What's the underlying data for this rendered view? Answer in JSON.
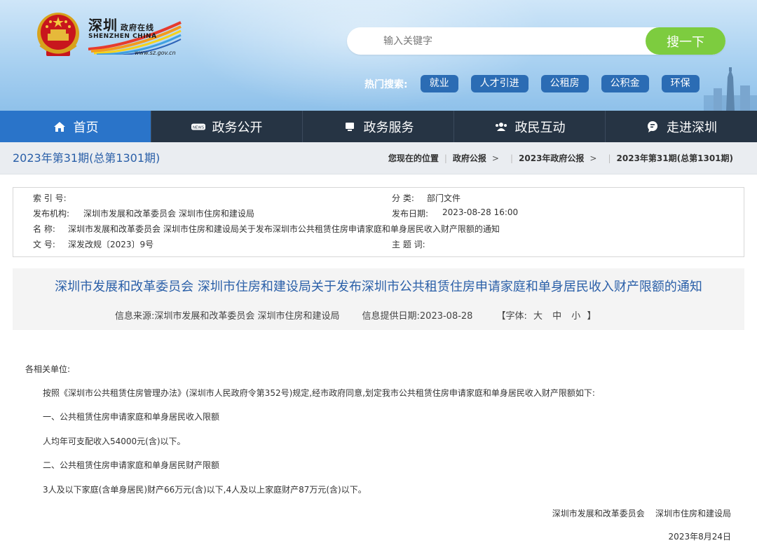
{
  "header": {
    "logo": {
      "cn": "深圳",
      "cn_small": "政府在线",
      "en": "SHENZHEN CHINA",
      "url": "www.sz.gov.cn"
    },
    "search": {
      "placeholder": "输入关键字",
      "button": "搜一下"
    },
    "hot": {
      "label": "热门搜索:",
      "tags": [
        "就业",
        "人才引进",
        "公租房",
        "公积金",
        "环保"
      ]
    }
  },
  "nav": {
    "items": [
      {
        "label": "首页",
        "icon": "home-icon"
      },
      {
        "label": "政务公开",
        "icon": "news-icon"
      },
      {
        "label": "政务服务",
        "icon": "monitor-icon"
      },
      {
        "label": "政民互动",
        "icon": "people-icon"
      },
      {
        "label": "走进深圳",
        "icon": "chat-icon"
      }
    ]
  },
  "breadcrumb": {
    "issue": "2023年第31期(总第1301期)",
    "location_label": "您现在的位置",
    "items": [
      "政府公报",
      "2023年政府公报",
      "2023年第31期(总第1301期)"
    ]
  },
  "meta": {
    "index_label": "索 引 号:",
    "index_value": "",
    "category_label": "分 类:",
    "category_value": "部门文件",
    "publisher_label": "发布机构:",
    "publisher_value": "深圳市发展和改革委员会 深圳市住房和建设局",
    "date_label": "发布日期:",
    "date_value": "2023-08-28 16:00",
    "name_label": "名 称:",
    "name_value": "深圳市发展和改革委员会 深圳市住房和建设局关于发布深圳市公共租赁住房申请家庭和单身居民收入财产限额的通知",
    "docno_label": "文 号:",
    "docno_value": "深发改规〔2023〕9号",
    "subject_label": "主 题 词:",
    "subject_value": ""
  },
  "article": {
    "title": "深圳市发展和改革委员会 深圳市住房和建设局关于发布深圳市公共租赁住房申请家庭和单身居民收入财产限额的通知",
    "source": "信息来源:深圳市发展和改革委员会 深圳市住房和建设局",
    "provided_date": "信息提供日期:2023-08-28",
    "font_label_open": "【字体:",
    "font_large": "大",
    "font_medium": "中",
    "font_small": "小",
    "font_label_close": "】",
    "salutation": "各相关单位:",
    "paragraphs": [
      "按照《深圳市公共租赁住房管理办法》(深圳市人民政府令第352号)规定,经市政府同意,划定我市公共租赁住房申请家庭和单身居民收入财产限额如下:",
      "一、公共租赁住房申请家庭和单身居民收入限额",
      "人均年可支配收入54000元(含)以下。",
      "二、公共租赁住房申请家庭和单身居民财产限额",
      "3人及以下家庭(含单身居民)财产66万元(含)以下,4人及以上家庭财产87万元(含)以下。"
    ],
    "signature": "深圳市发展和改革委员会    深圳市住房和建设局",
    "date": "2023年8月24日"
  }
}
